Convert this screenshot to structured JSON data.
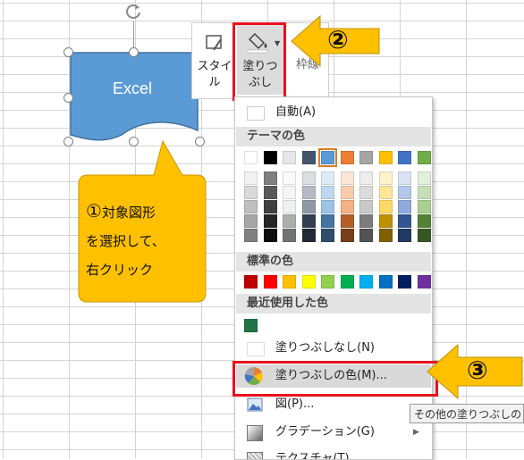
{
  "shape": {
    "label": "Excel",
    "fill": "#5b9bd5"
  },
  "mini_toolbar": {
    "style_label_1": "スタイ",
    "style_label_2": "ル",
    "fill_label_1": "塗りつ",
    "fill_label_2": "ぶし",
    "outline_label": "枠線"
  },
  "menu": {
    "auto_label": "自動(A)",
    "theme_colors_header": "テーマの色",
    "standard_colors_header": "標準の色",
    "recent_colors_header": "最近使用した色",
    "no_fill_label": "塗りつぶしなし(N)",
    "more_colors_label": "塗りつぶしの色(M)...",
    "picture_label": "図(P)...",
    "gradient_label": "グラデーション(G)",
    "texture_label": "テクスチャ(T)",
    "theme_colors": [
      "#ffffff",
      "#000000",
      "#e7e6e6",
      "#44546a",
      "#5b9bd5",
      "#ed7d31",
      "#a5a5a5",
      "#ffc000",
      "#4472c4",
      "#70ad47"
    ],
    "standard_colors": [
      "#c00000",
      "#ff0000",
      "#ffc000",
      "#ffff00",
      "#92d050",
      "#00b050",
      "#00b0f0",
      "#0070c0",
      "#002060",
      "#7030a0"
    ],
    "recent_colors": [
      "#217346"
    ]
  },
  "tooltip": "その他の塗りつぶしの",
  "callout": {
    "line1_num": "①",
    "line1_text": "対象図形",
    "line2": "を選択して、",
    "line3": "右クリック",
    "fill": "#ffc000"
  },
  "step2_label": "②",
  "step3_label": "③",
  "highlight_color": "#e8121d"
}
